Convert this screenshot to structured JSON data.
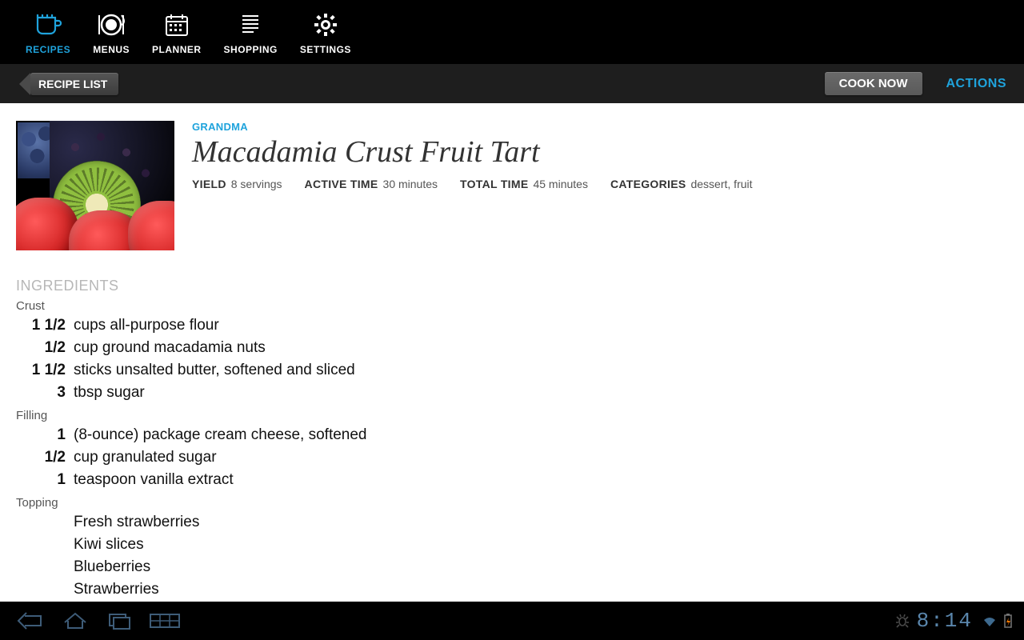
{
  "nav": {
    "items": [
      {
        "label": "RECIPES"
      },
      {
        "label": "MENUS"
      },
      {
        "label": "PLANNER"
      },
      {
        "label": "SHOPPING"
      },
      {
        "label": "SETTINGS"
      }
    ]
  },
  "subbar": {
    "back_label": "RECIPE LIST",
    "cook_now": "COOK NOW",
    "actions": "ACTIONS"
  },
  "recipe": {
    "source": "GRANDMA",
    "title": "Macadamia Crust Fruit Tart",
    "yield_k": "YIELD",
    "yield_v": "8 servings",
    "active_k": "ACTIVE TIME",
    "active_v": "30 minutes",
    "total_k": "TOTAL TIME",
    "total_v": "45 minutes",
    "cat_k": "CATEGORIES",
    "cat_v": "dessert, fruit"
  },
  "ingredients_h": "INGREDIENTS",
  "groups": [
    {
      "name": "Crust",
      "items": [
        {
          "qty": "1 1/2",
          "desc": "cups all-purpose flour"
        },
        {
          "qty": "1/2",
          "desc": "cup ground macadamia nuts"
        },
        {
          "qty": "1 1/2",
          "desc": "sticks unsalted butter, softened and sliced"
        },
        {
          "qty": "3",
          "desc": "tbsp sugar"
        }
      ]
    },
    {
      "name": "Filling",
      "items": [
        {
          "qty": "1",
          "desc": "(8-ounce) package cream cheese, softened"
        },
        {
          "qty": "1/2",
          "desc": "cup granulated sugar"
        },
        {
          "qty": "1",
          "desc": "teaspoon vanilla extract"
        }
      ]
    },
    {
      "name": "Topping",
      "items": [
        {
          "qty": "",
          "desc": "Fresh strawberries"
        },
        {
          "qty": "",
          "desc": "Kiwi slices"
        },
        {
          "qty": "",
          "desc": "Blueberries"
        },
        {
          "qty": "",
          "desc": "Strawberries"
        }
      ]
    }
  ],
  "sysbar": {
    "time": "8:14"
  }
}
